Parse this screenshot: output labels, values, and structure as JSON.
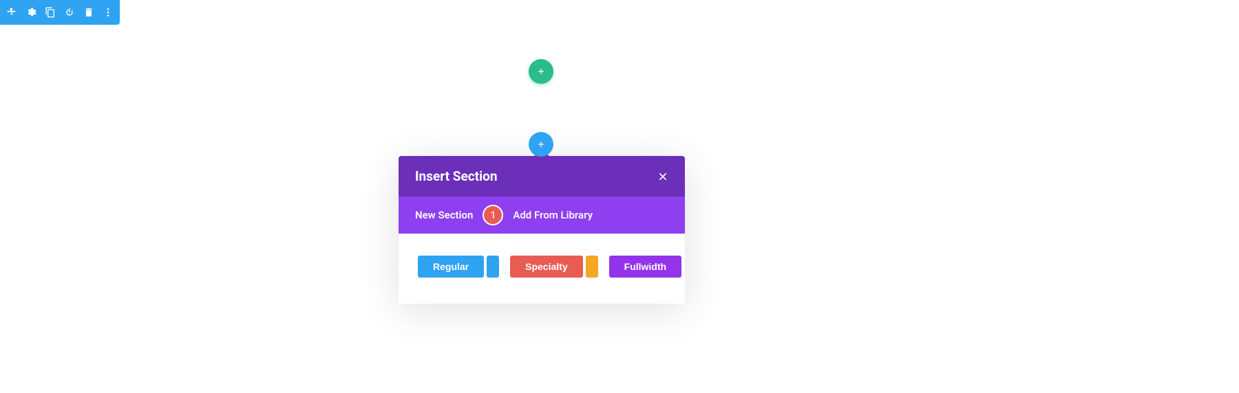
{
  "toolbar": {
    "icons": [
      "move",
      "gear",
      "duplicate",
      "power",
      "trash",
      "more"
    ]
  },
  "add_buttons": {
    "teal": "add-row",
    "blue": "add-section"
  },
  "panel": {
    "title": "Insert Section",
    "tabs": {
      "new_section": "New Section",
      "add_from_library": "Add From Library"
    },
    "step_badge": "1",
    "buttons": {
      "regular": "Regular",
      "specialty": "Specialty",
      "fullwidth": "Fullwidth"
    }
  },
  "colors": {
    "toolbar_blue": "#2ea3f2",
    "teal": "#2cbb8b",
    "purple_dark": "#6c2fb9",
    "purple_mid": "#8e3ff0",
    "purple_btn": "#9333ea",
    "red": "#e85c53",
    "orange": "#f5a623"
  }
}
